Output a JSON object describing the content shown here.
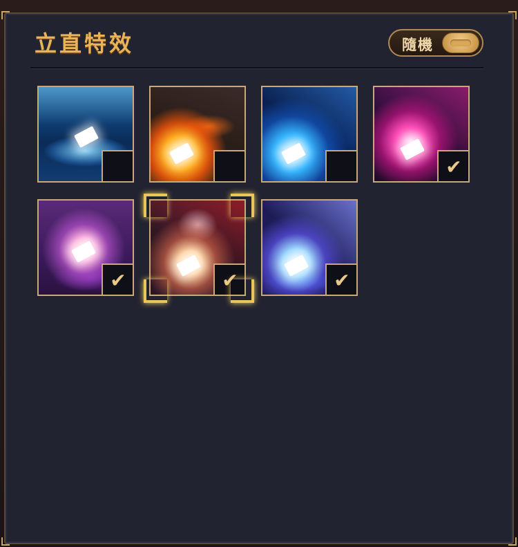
{
  "header": {
    "title": "立直特效",
    "random_label": "隨機",
    "random_toggle_on": true
  },
  "effects": [
    {
      "name": "blue-crackle-effect",
      "owned": false,
      "selected": false
    },
    {
      "name": "fire-comet-effect",
      "owned": false,
      "selected": false
    },
    {
      "name": "blue-trail-effect",
      "owned": false,
      "selected": false
    },
    {
      "name": "pink-chain-effect",
      "owned": true,
      "selected": false
    },
    {
      "name": "paw-burst-effect",
      "owned": true,
      "selected": false
    },
    {
      "name": "phoenix-effect",
      "owned": true,
      "selected": true
    },
    {
      "name": "lightning-strike-effect",
      "owned": true,
      "selected": false
    }
  ],
  "check_glyph": "✔",
  "colors": {
    "accent_gold": "#e9b35a",
    "panel": "#222330",
    "border": "#c9a979",
    "selection": "#e8c65a"
  }
}
